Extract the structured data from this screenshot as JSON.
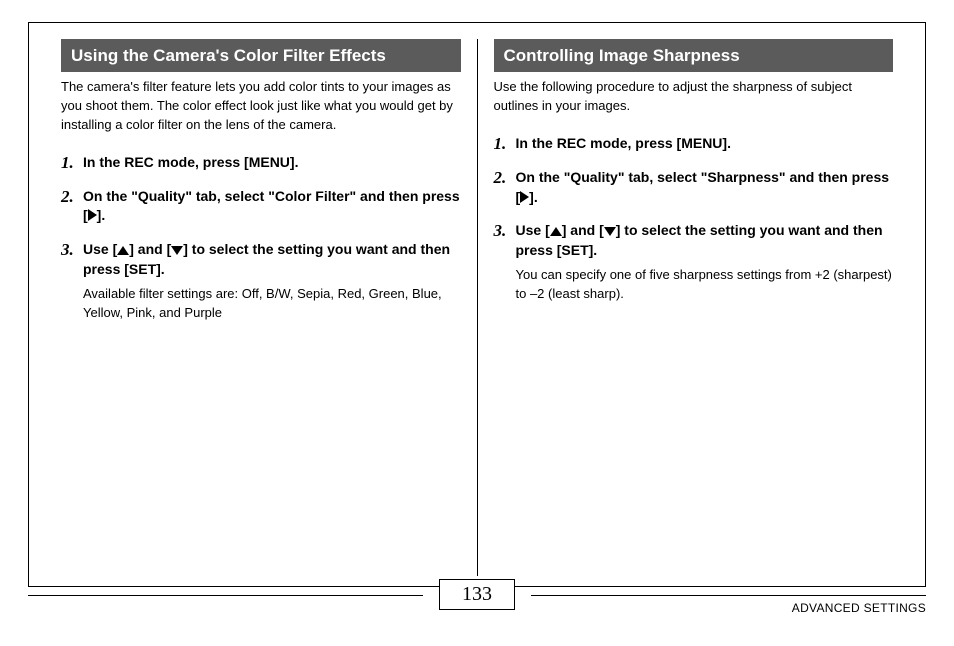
{
  "left": {
    "header": "Using the Camera's Color Filter Effects",
    "intro": "The camera's filter feature lets you add color tints to your images as you shoot them. The color effect look just like what you would get by installing a color filter on the lens of the camera.",
    "steps": [
      {
        "num": "1.",
        "title": "In the REC mode, press [MENU]."
      },
      {
        "num": "2.",
        "title_before": "On the \"Quality\" tab, select \"Color Filter\" and then press [",
        "title_after": "]."
      },
      {
        "num": "3.",
        "title_before": "Use [",
        "title_mid": "] and [",
        "title_after": "] to select the setting you want and then press [SET].",
        "note": "Available filter settings are: Off, B/W, Sepia, Red, Green, Blue, Yellow, Pink, and Purple"
      }
    ]
  },
  "right": {
    "header": "Controlling Image Sharpness",
    "intro": "Use the following procedure to adjust the sharpness of subject outlines in your images.",
    "steps": [
      {
        "num": "1.",
        "title": "In the REC mode, press [MENU]."
      },
      {
        "num": "2.",
        "title_before": "On the \"Quality\" tab, select \"Sharpness\" and then press [",
        "title_after": "]."
      },
      {
        "num": "3.",
        "title_before": "Use [",
        "title_mid": "] and [",
        "title_after": "] to select the setting you want and then press [SET].",
        "note": "You can specify one of five sharpness settings from +2 (sharpest) to –2 (least sharp)."
      }
    ]
  },
  "footer": {
    "page": "133",
    "label": "ADVANCED SETTINGS"
  }
}
